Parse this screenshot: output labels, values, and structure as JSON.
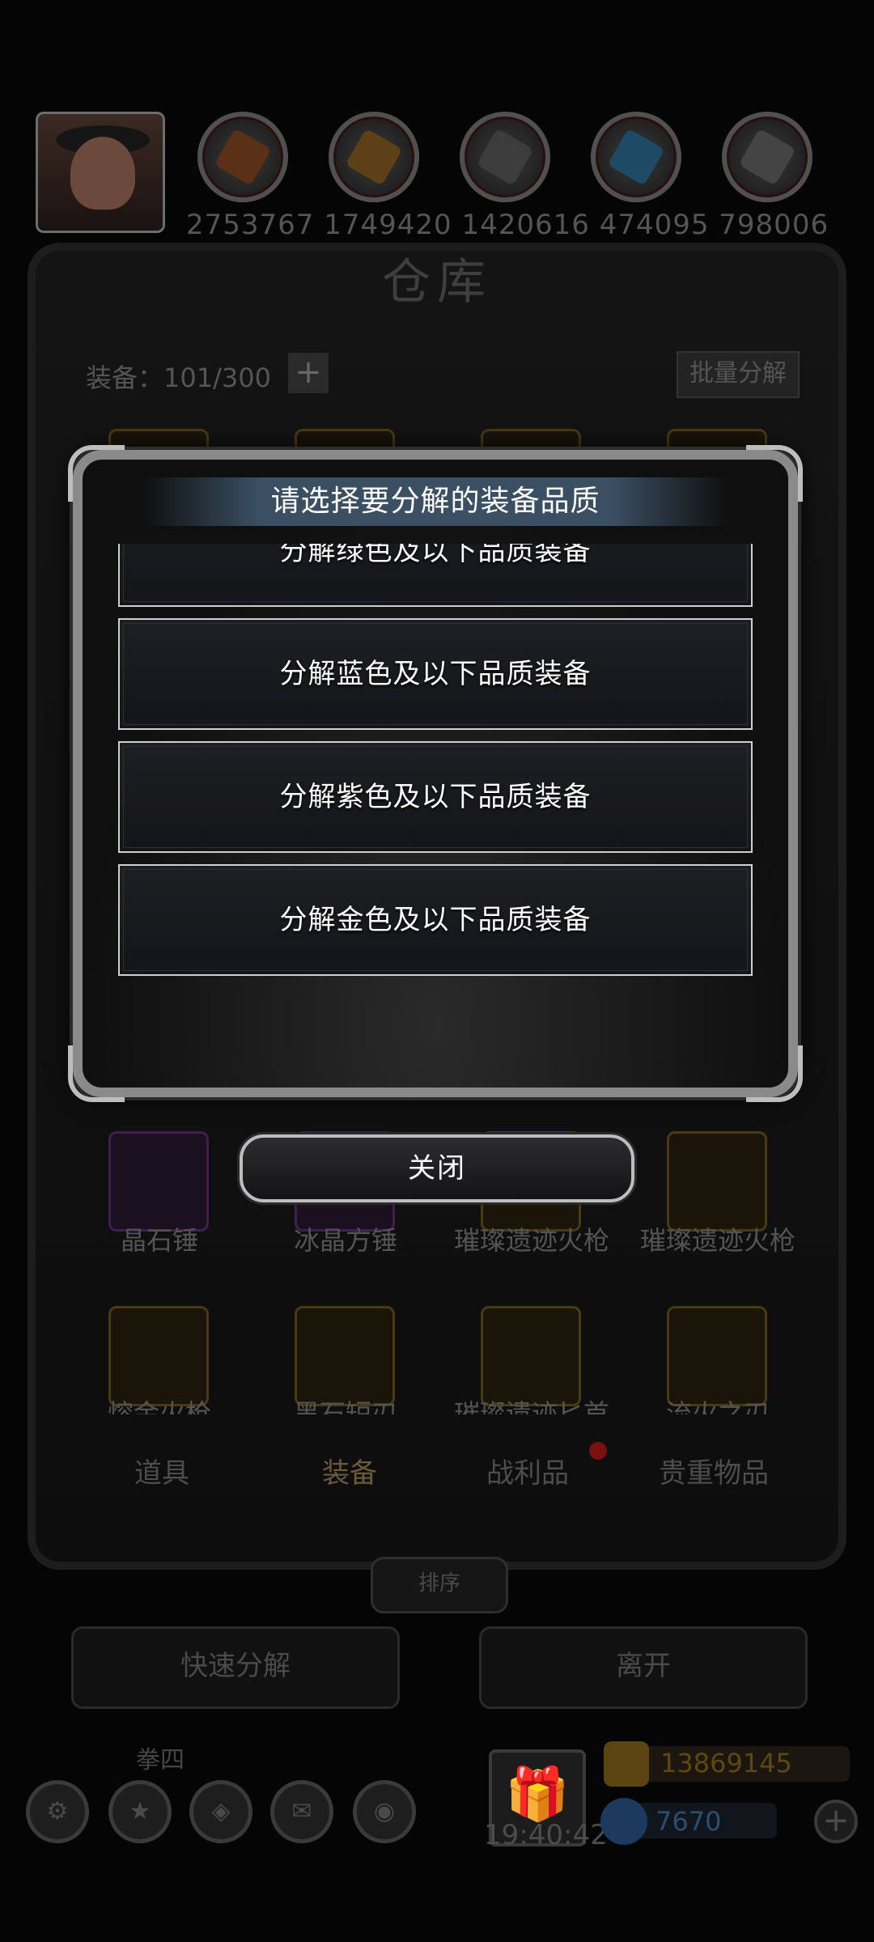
{
  "resources": {
    "values_line": "2753767 1749420 1420616 474095 798006",
    "icons": [
      "avatar-portrait",
      "bread-icon",
      "wood-planks-icon",
      "iron-ingots-icon",
      "blue-crystal-icon",
      "steel-ingots-icon"
    ]
  },
  "warehouse": {
    "title": "仓库",
    "equip_count": "装备：101/300",
    "batch_decompose": "批量分解",
    "items_row1": [
      "晶石锤",
      "冰晶方锤",
      "璀璨遗迹火枪",
      "璀璨遗迹火枪"
    ],
    "items_row2": [
      "熔金火枪",
      "黑石短刃",
      "璀璨遗迹匕首",
      "流火之刃"
    ],
    "tabs": [
      "道具",
      "装备",
      "战利品",
      "贵重物品"
    ],
    "sort": "排序",
    "quick_decompose": "快速分解",
    "leave": "离开"
  },
  "player": {
    "name": "拳四",
    "time": "19:40:42",
    "gold": "13869145",
    "gems": "7670"
  },
  "modal": {
    "title": "请选择要分解的装备品质",
    "options": [
      "分解绿色及以下品质装备",
      "分解蓝色及以下品质装备",
      "分解紫色及以下品质装备",
      "分解金色及以下品质装备"
    ],
    "close": "关闭"
  },
  "colors": {
    "modal_border": "#8a8a8a",
    "option_border": "#cfcfcf",
    "title_bar": "#46607a"
  }
}
